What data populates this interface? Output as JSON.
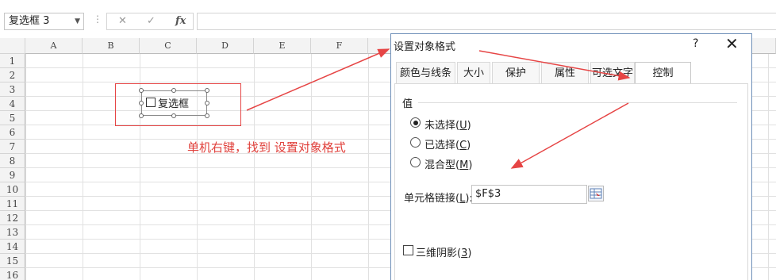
{
  "formula_bar": {
    "name_box": "复选框 3",
    "dropdown_glyph": "▼",
    "separator_glyph": "⋮",
    "cancel_glyph": "✕",
    "enter_glyph": "✓",
    "fx_label": "fx",
    "formula_value": ""
  },
  "sheet": {
    "columns": [
      "A",
      "B",
      "C",
      "D",
      "E",
      "F"
    ],
    "rows": [
      "1",
      "2",
      "3",
      "4",
      "5",
      "6",
      "7",
      "8",
      "9",
      "10",
      "11",
      "12",
      "13",
      "14",
      "15",
      "16"
    ],
    "checkbox_label": "复选框"
  },
  "annotation": {
    "note": "单机右键，找到 设置对象格式",
    "color": "#e64545"
  },
  "dialog": {
    "title": "设置对象格式",
    "help": "?",
    "close": "✕",
    "tabs": [
      "颜色与线条",
      "大小",
      "保护",
      "属性",
      "可选文字",
      "控制"
    ],
    "active_tab": "控制",
    "value_group_label": "值",
    "radios": [
      {
        "label": "未选择",
        "key": "U",
        "checked": true
      },
      {
        "label": "已选择",
        "key": "C",
        "checked": false
      },
      {
        "label": "混合型",
        "key": "M",
        "checked": false
      }
    ],
    "cell_link_label": "单元格链接",
    "cell_link_key": "L",
    "cell_link_value": "$F$3",
    "shading_label": "三维阴影",
    "shading_key": "3"
  }
}
